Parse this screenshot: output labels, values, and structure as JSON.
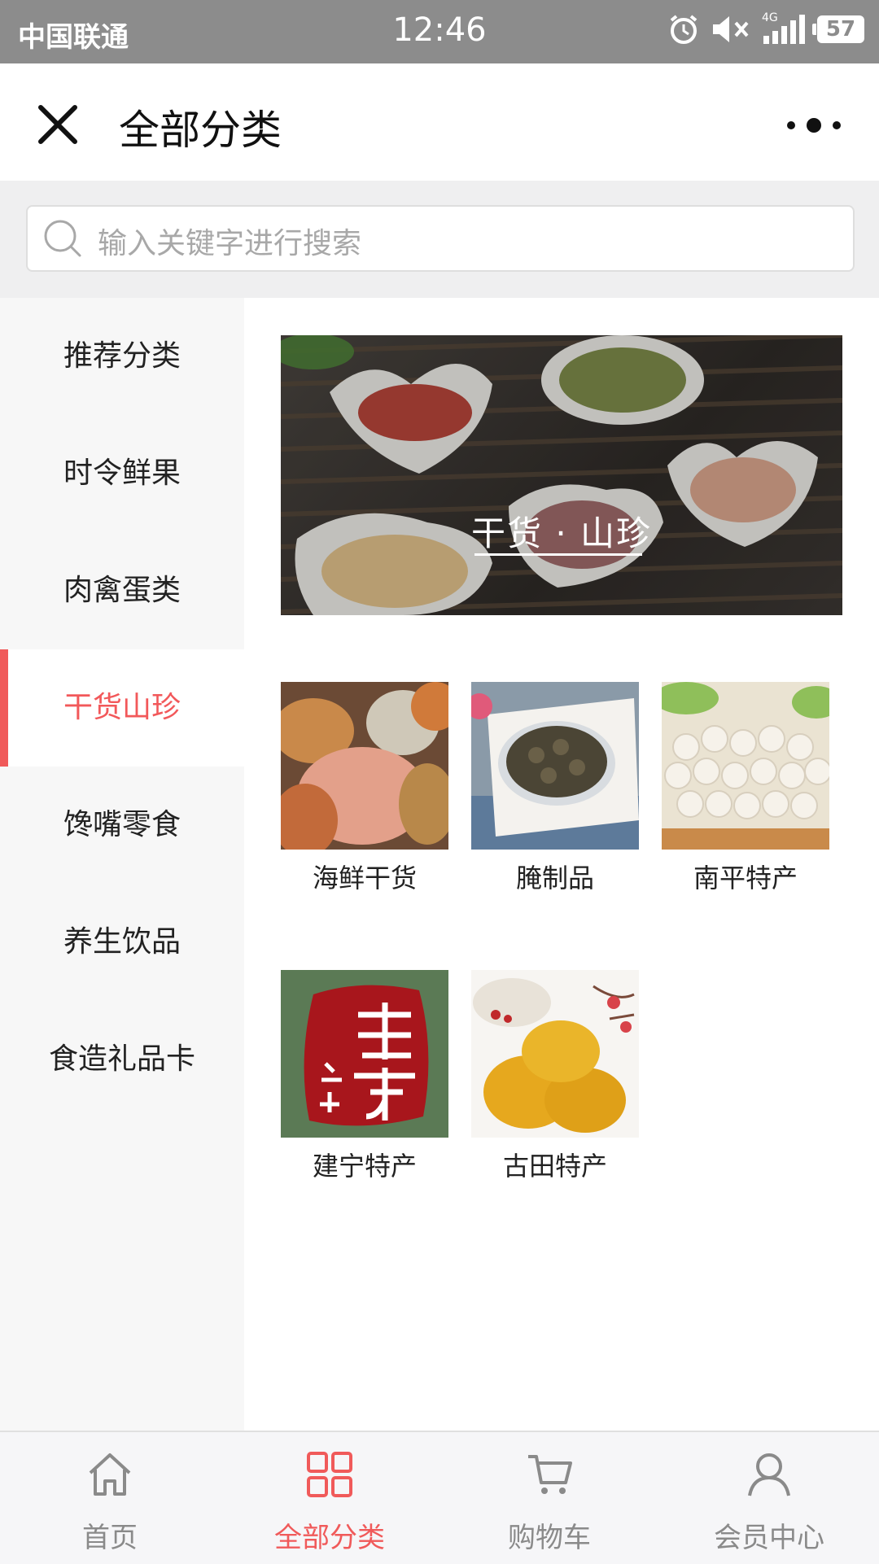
{
  "status_bar": {
    "carrier": "中国联通",
    "time": "12:46",
    "network": "4G",
    "battery": "57"
  },
  "nav": {
    "title": "全部分类"
  },
  "search": {
    "placeholder": "输入关键字进行搜索"
  },
  "sidebar": {
    "items": [
      {
        "label": "推荐分类"
      },
      {
        "label": "时令鲜果"
      },
      {
        "label": "肉禽蛋类"
      },
      {
        "label": "干货山珍"
      },
      {
        "label": "馋嘴零食"
      },
      {
        "label": "养生饮品"
      },
      {
        "label": "食造礼品卡"
      }
    ],
    "active_index": 3
  },
  "banner": {
    "title": "干货 · 山珍"
  },
  "subcategories": [
    {
      "label": "海鲜干货"
    },
    {
      "label": "腌制品"
    },
    {
      "label": "南平特产"
    },
    {
      "label": "建宁特产",
      "logo_text": "建宁 公主"
    },
    {
      "label": "古田特产"
    }
  ],
  "tabbar": {
    "tabs": [
      {
        "label": "首页",
        "icon": "home-icon"
      },
      {
        "label": "全部分类",
        "icon": "grid-icon"
      },
      {
        "label": "购物车",
        "icon": "cart-icon"
      },
      {
        "label": "会员中心",
        "icon": "user-icon"
      }
    ],
    "active_index": 1
  },
  "colors": {
    "accent": "#f05a5a",
    "status_bar": "#8c8c8c",
    "sidebar_bg": "#f7f7f7"
  }
}
